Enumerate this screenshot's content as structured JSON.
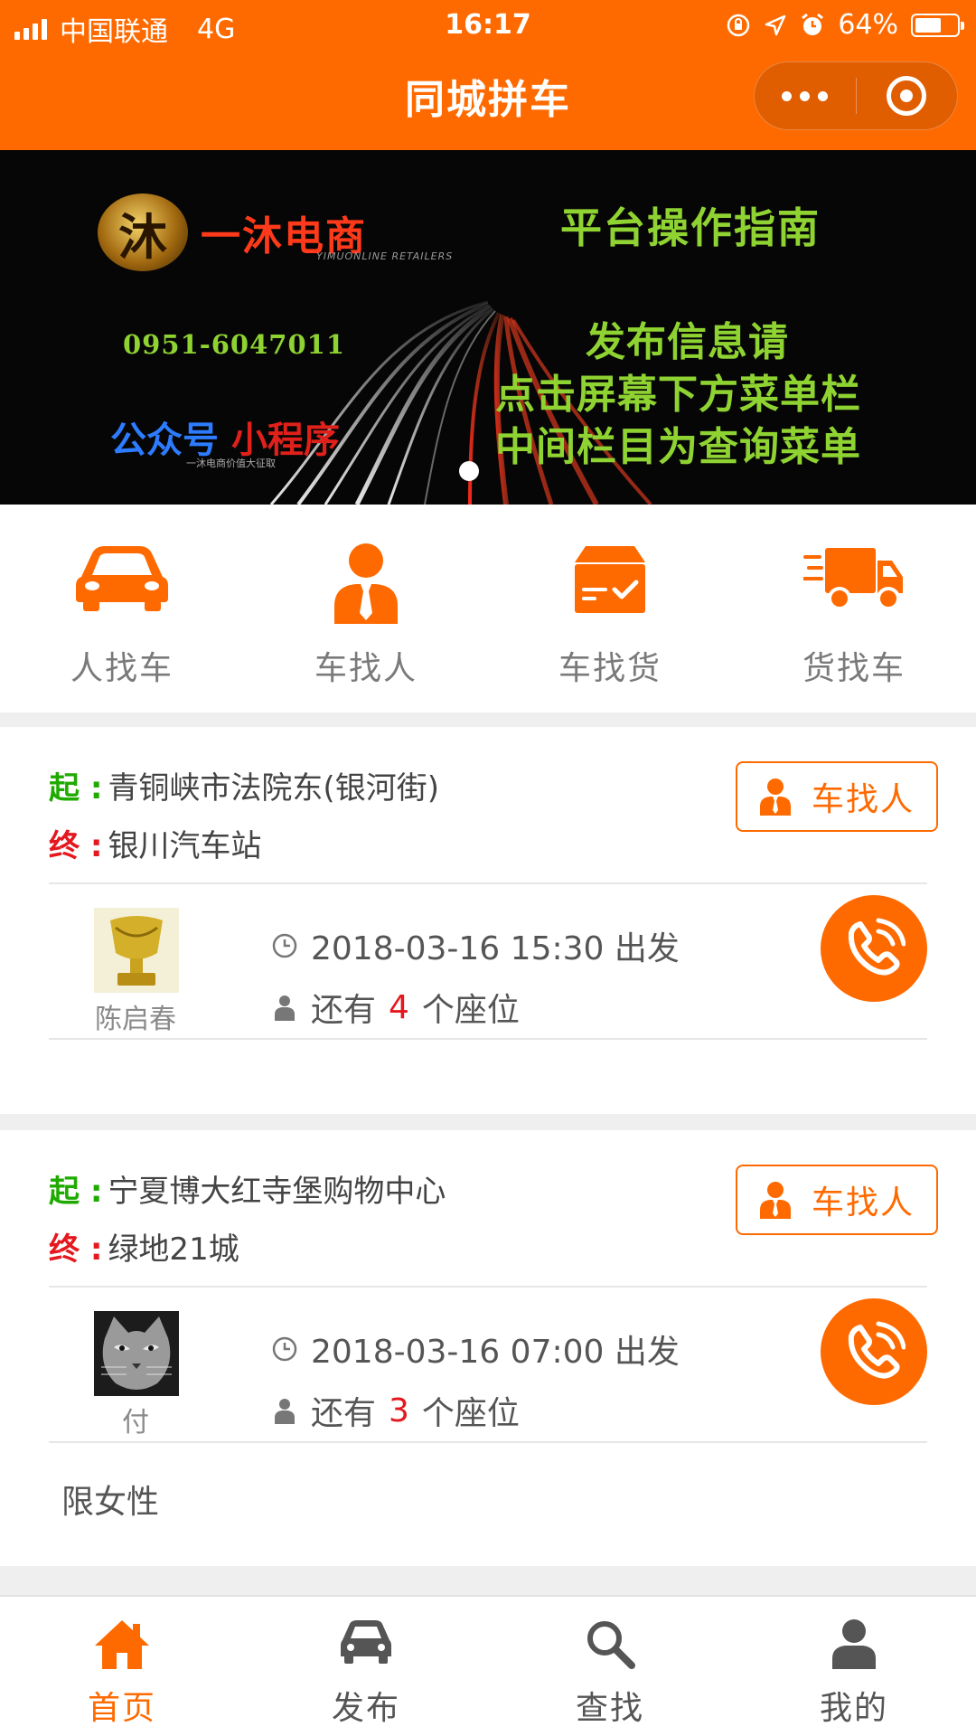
{
  "status_bar": {
    "carrier": "中国联通",
    "network": "4G",
    "time": "16:17",
    "battery": "64%",
    "battery_level": 0.64
  },
  "nav": {
    "title": "同城拼车"
  },
  "banner": {
    "brand_name": "一沐电商",
    "brand_sub": "YIMUONLINE RETAILERS",
    "phone": "0951-6047011",
    "pub_blue": "公众号",
    "pub_red": "小程序",
    "pub_small": "一沐电商价值大征取",
    "guide": "平台操作指南",
    "line1": "发布信息请",
    "line2": "点击屏幕下方菜单栏",
    "line3": "中间栏目为查询菜单"
  },
  "categories": [
    {
      "label": "人找车",
      "icon": "car-icon"
    },
    {
      "label": "车找人",
      "icon": "person-icon"
    },
    {
      "label": "车找货",
      "icon": "cargo-box-icon"
    },
    {
      "label": "货找车",
      "icon": "truck-icon"
    }
  ],
  "posts": [
    {
      "start_key": "起 :",
      "start": "青铜峡市法院东(银河街)",
      "end_key": "终 :",
      "end": "银川汽车站",
      "tag": "车找人",
      "user": "陈启春",
      "datetime": "2018-03-16 15:30 出发",
      "seats_prefix": "还有",
      "seats": "4",
      "seats_suffix": "个座位",
      "note": ""
    },
    {
      "start_key": "起 :",
      "start": "宁夏博大红寺堡购物中心",
      "end_key": "终 :",
      "end": "绿地21城",
      "tag": "车找人",
      "user": "付",
      "datetime": "2018-03-16 07:00 出发",
      "seats_prefix": "还有",
      "seats": "3",
      "seats_suffix": "个座位",
      "note": "限女性"
    }
  ],
  "tabbar": [
    {
      "label": "首页",
      "icon": "home-icon",
      "active": true
    },
    {
      "label": "发布",
      "icon": "car-icon",
      "active": false
    },
    {
      "label": "查找",
      "icon": "search-icon",
      "active": false
    },
    {
      "label": "我的",
      "icon": "user-icon",
      "active": false
    }
  ],
  "colors": {
    "brand": "#ff6a00",
    "start_label": "#1faa00",
    "end_label": "#e4181e",
    "seat_count": "#e4181e"
  }
}
